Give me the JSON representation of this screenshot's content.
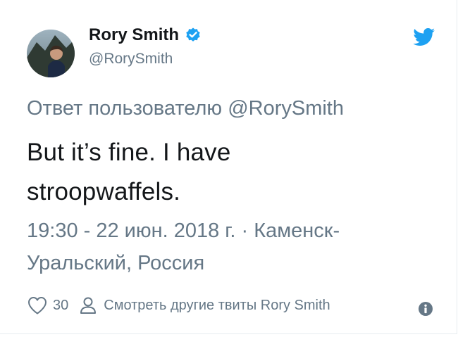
{
  "author": {
    "name": "Rory Smith",
    "handle": "@RorySmith",
    "verified": true,
    "avatar_icon": "profile-photo"
  },
  "reply": {
    "label": "Ответ пользователю",
    "mention": "@RorySmith"
  },
  "tweet": {
    "text": "But it’s fine. I have stroopwaffels.",
    "timestamp": "19:30 - 22 июн. 2018 г.",
    "separator": "·",
    "location": "Каменск-Уральский, Россия"
  },
  "actions": {
    "like_count": "30",
    "more_tweets_label": "Смотреть другие твиты Rory Smith"
  },
  "icons": {
    "brand": "twitter-bird-icon",
    "like": "heart-icon",
    "person": "person-icon",
    "info": "info-icon",
    "verified": "verified-badge-icon"
  },
  "colors": {
    "brand_blue": "#1da1f2",
    "text_primary": "#14171a",
    "text_secondary": "#657786"
  }
}
